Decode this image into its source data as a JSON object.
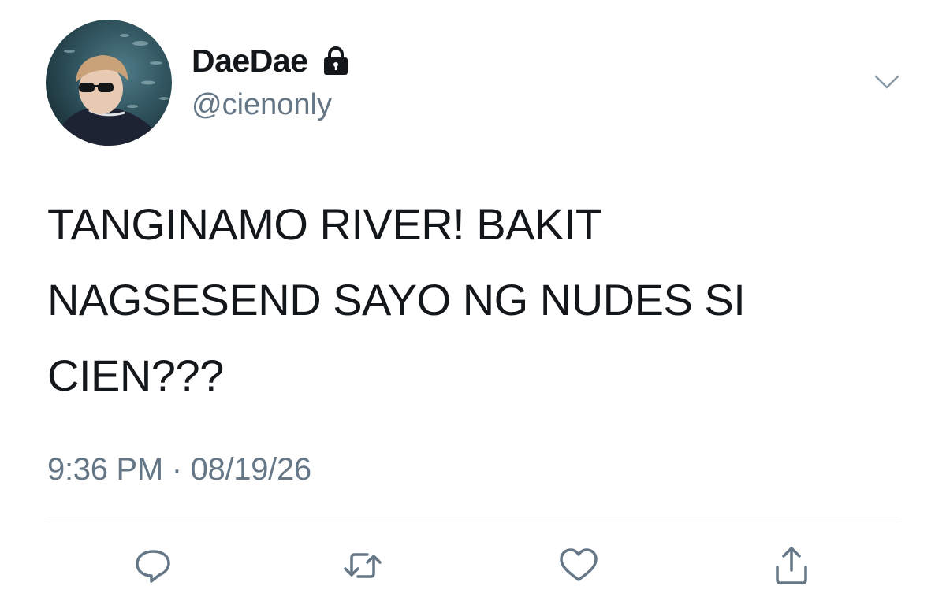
{
  "tweet": {
    "author": {
      "display_name": "DaeDae",
      "handle": "@cienonly",
      "protected_icon": "lock-icon",
      "avatar": "profile-photo"
    },
    "text_lines": [
      "TANGINAMO RIVER! BAKIT",
      "NAGSESEND SAYO NG NUDES SI",
      "CIEN???"
    ],
    "time": "9:36 PM",
    "separator": "·",
    "date": "08/19/26",
    "menu_icon": "chevron-down-icon",
    "actions": [
      {
        "name": "reply",
        "icon": "reply-icon"
      },
      {
        "name": "retweet",
        "icon": "retweet-icon"
      },
      {
        "name": "like",
        "icon": "heart-icon"
      },
      {
        "name": "share",
        "icon": "share-icon"
      }
    ]
  },
  "colors": {
    "text": "#14171a",
    "secondary": "#657786",
    "divider": "#e1e8ed"
  }
}
